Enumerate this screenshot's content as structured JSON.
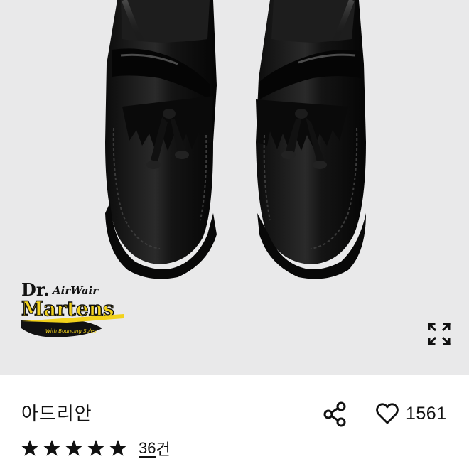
{
  "hero": {
    "image_alt": "Black leather tassel loafers with kiltie fringe",
    "brand_logo": {
      "line1": "Dr.",
      "line1_suffix": "AirWair",
      "line2": "Martens",
      "tagline": "With Bouncing Soles"
    },
    "expand_icon": "expand-icon"
  },
  "product": {
    "name": "아드리안",
    "like_count": "1561",
    "rating_stars": 5,
    "review_count": "36",
    "review_unit": "건"
  },
  "colors": {
    "hero_bg": "#e9e9ea",
    "text": "#111111",
    "logo_yellow": "#f2d21b"
  }
}
